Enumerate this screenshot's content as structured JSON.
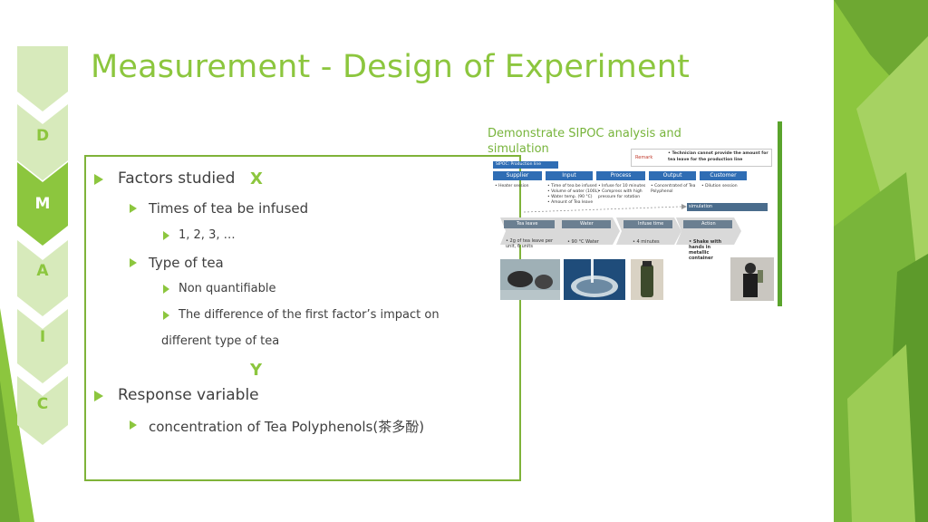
{
  "slide": {
    "title": "Measurement - Design of Experiment"
  },
  "dmaic": [
    "D",
    "M",
    "A",
    "I",
    "C"
  ],
  "active_phase": "M",
  "content": {
    "factors_label": "Factors studied",
    "factors_marker": "X",
    "factor1": "Times of tea be infused",
    "factor1_values": "1, 2, 3, …",
    "factor2": "Type of tea",
    "factor2_note": "Non quantifiable",
    "factor2_line1": "The difference of the first factor’s impact on",
    "factor2_line2": "different type of tea",
    "response_marker": "Y",
    "response_label": "Response variable",
    "response_value": "concentration of Tea Polyphenols(茶多酚)"
  },
  "sipoc": {
    "title": "Demonstrate SIPOC analysis and simulation",
    "remark_label": "Remark",
    "remark_text1": "• Technician cannot provide the amount for",
    "remark_text2": "tea leave for the production line",
    "production_line": "SIPOC: Production line",
    "headers": [
      "Supplier",
      "Input",
      "Process",
      "Output",
      "Customer"
    ],
    "supplier": [
      "• Heater session"
    ],
    "input": [
      "• Time of tea be infused",
      "• Volume of water (100L)",
      "• Water temp. (90 °C)",
      "• Amount of Tea leave"
    ],
    "process": [
      "• Infuse for 10 minutes",
      "• Compress with high",
      "  pressure for rotation"
    ],
    "output": [
      "• Concentrated of Tea",
      "  Polyphenol"
    ],
    "customer": [
      "• Dilution session"
    ],
    "simulation_label": "simulation",
    "steps": [
      "Tea leave",
      "Water",
      "Infuse time",
      "Action"
    ],
    "step_details": [
      [
        "• 2g of tea leave per",
        "  unit, 6 units"
      ],
      [
        "• 90 °C Water"
      ],
      [
        "• 4 minutes"
      ],
      [
        "• Shake with",
        "  hands in",
        "  metallic",
        "  container"
      ]
    ]
  }
}
